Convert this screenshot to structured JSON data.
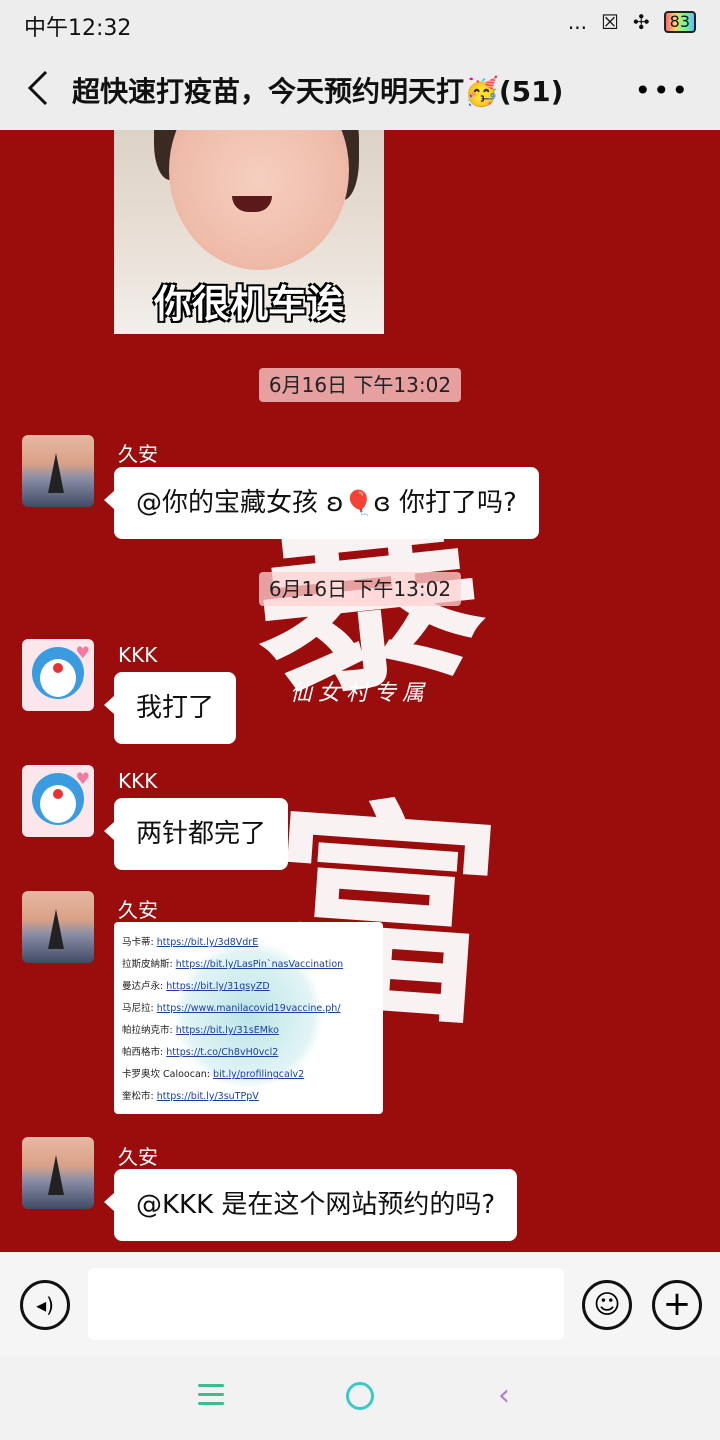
{
  "status_bar": {
    "time": "中午12:32",
    "signal": "...",
    "battery": "83"
  },
  "header": {
    "title": "超快速打疫苗，今天预约明天打🥳(51)",
    "back_label": "返回",
    "more_label": "•••"
  },
  "background": {
    "calligraphy_top": "暴",
    "calligraphy_bottom": "富",
    "calligraphy_sub": "仙女村专属"
  },
  "sticker": {
    "caption": "你很机车诶"
  },
  "messages": [
    {
      "type": "timestamp",
      "text": "6月16日 下午13:02"
    },
    {
      "type": "text",
      "sender": "久安",
      "avatar": "sunset-boat",
      "text_pre": "@你的宝藏女孩 ʚ",
      "emoji": "🎈",
      "text_post": "ɞ 你打了吗?"
    },
    {
      "type": "timestamp",
      "text": "6月16日 下午13:02"
    },
    {
      "type": "text",
      "sender": "KKK",
      "avatar": "doraemon",
      "text": "我打了"
    },
    {
      "type": "text",
      "sender": "KKK",
      "avatar": "doraemon",
      "text": "两针都完了"
    },
    {
      "type": "image",
      "sender": "久安",
      "avatar": "sunset-boat"
    },
    {
      "type": "text",
      "sender": "久安",
      "avatar": "sunset-boat",
      "text": "@KKK  是在这个网站预约的吗?"
    }
  ],
  "link_image": {
    "rows": [
      {
        "label": "马卡蒂:",
        "url": "https://bit.ly/3d8VdrE"
      },
      {
        "label": "拉斯皮納斯:",
        "url": "https://bit.ly/LasPin`nasVaccination"
      },
      {
        "label": "曼达卢永:",
        "url": "https://bit.ly/31qsyZD"
      },
      {
        "label": "马尼拉:",
        "url": "https://www.manilacovid19vaccine.ph/"
      },
      {
        "label": "帕拉纳克市:",
        "url": "https://bit.ly/31sEMko"
      },
      {
        "label": "帕西格市:",
        "url": "https://t.co/Ch8vH0vcl2"
      },
      {
        "label": "卡罗奥坎 Caloocan:",
        "url": "bit.ly/profilingcalv2"
      },
      {
        "label": "奎松市:",
        "url": "https://bit.ly/3suTPpV"
      }
    ]
  },
  "input_bar": {
    "placeholder": "",
    "voice_icon": "voice-icon",
    "emoji_icon": "emoji-icon",
    "plus_icon": "plus-icon"
  },
  "nav": {
    "menu_icon": "menu-icon",
    "home_icon": "home-icon",
    "back_icon": "back-icon"
  }
}
